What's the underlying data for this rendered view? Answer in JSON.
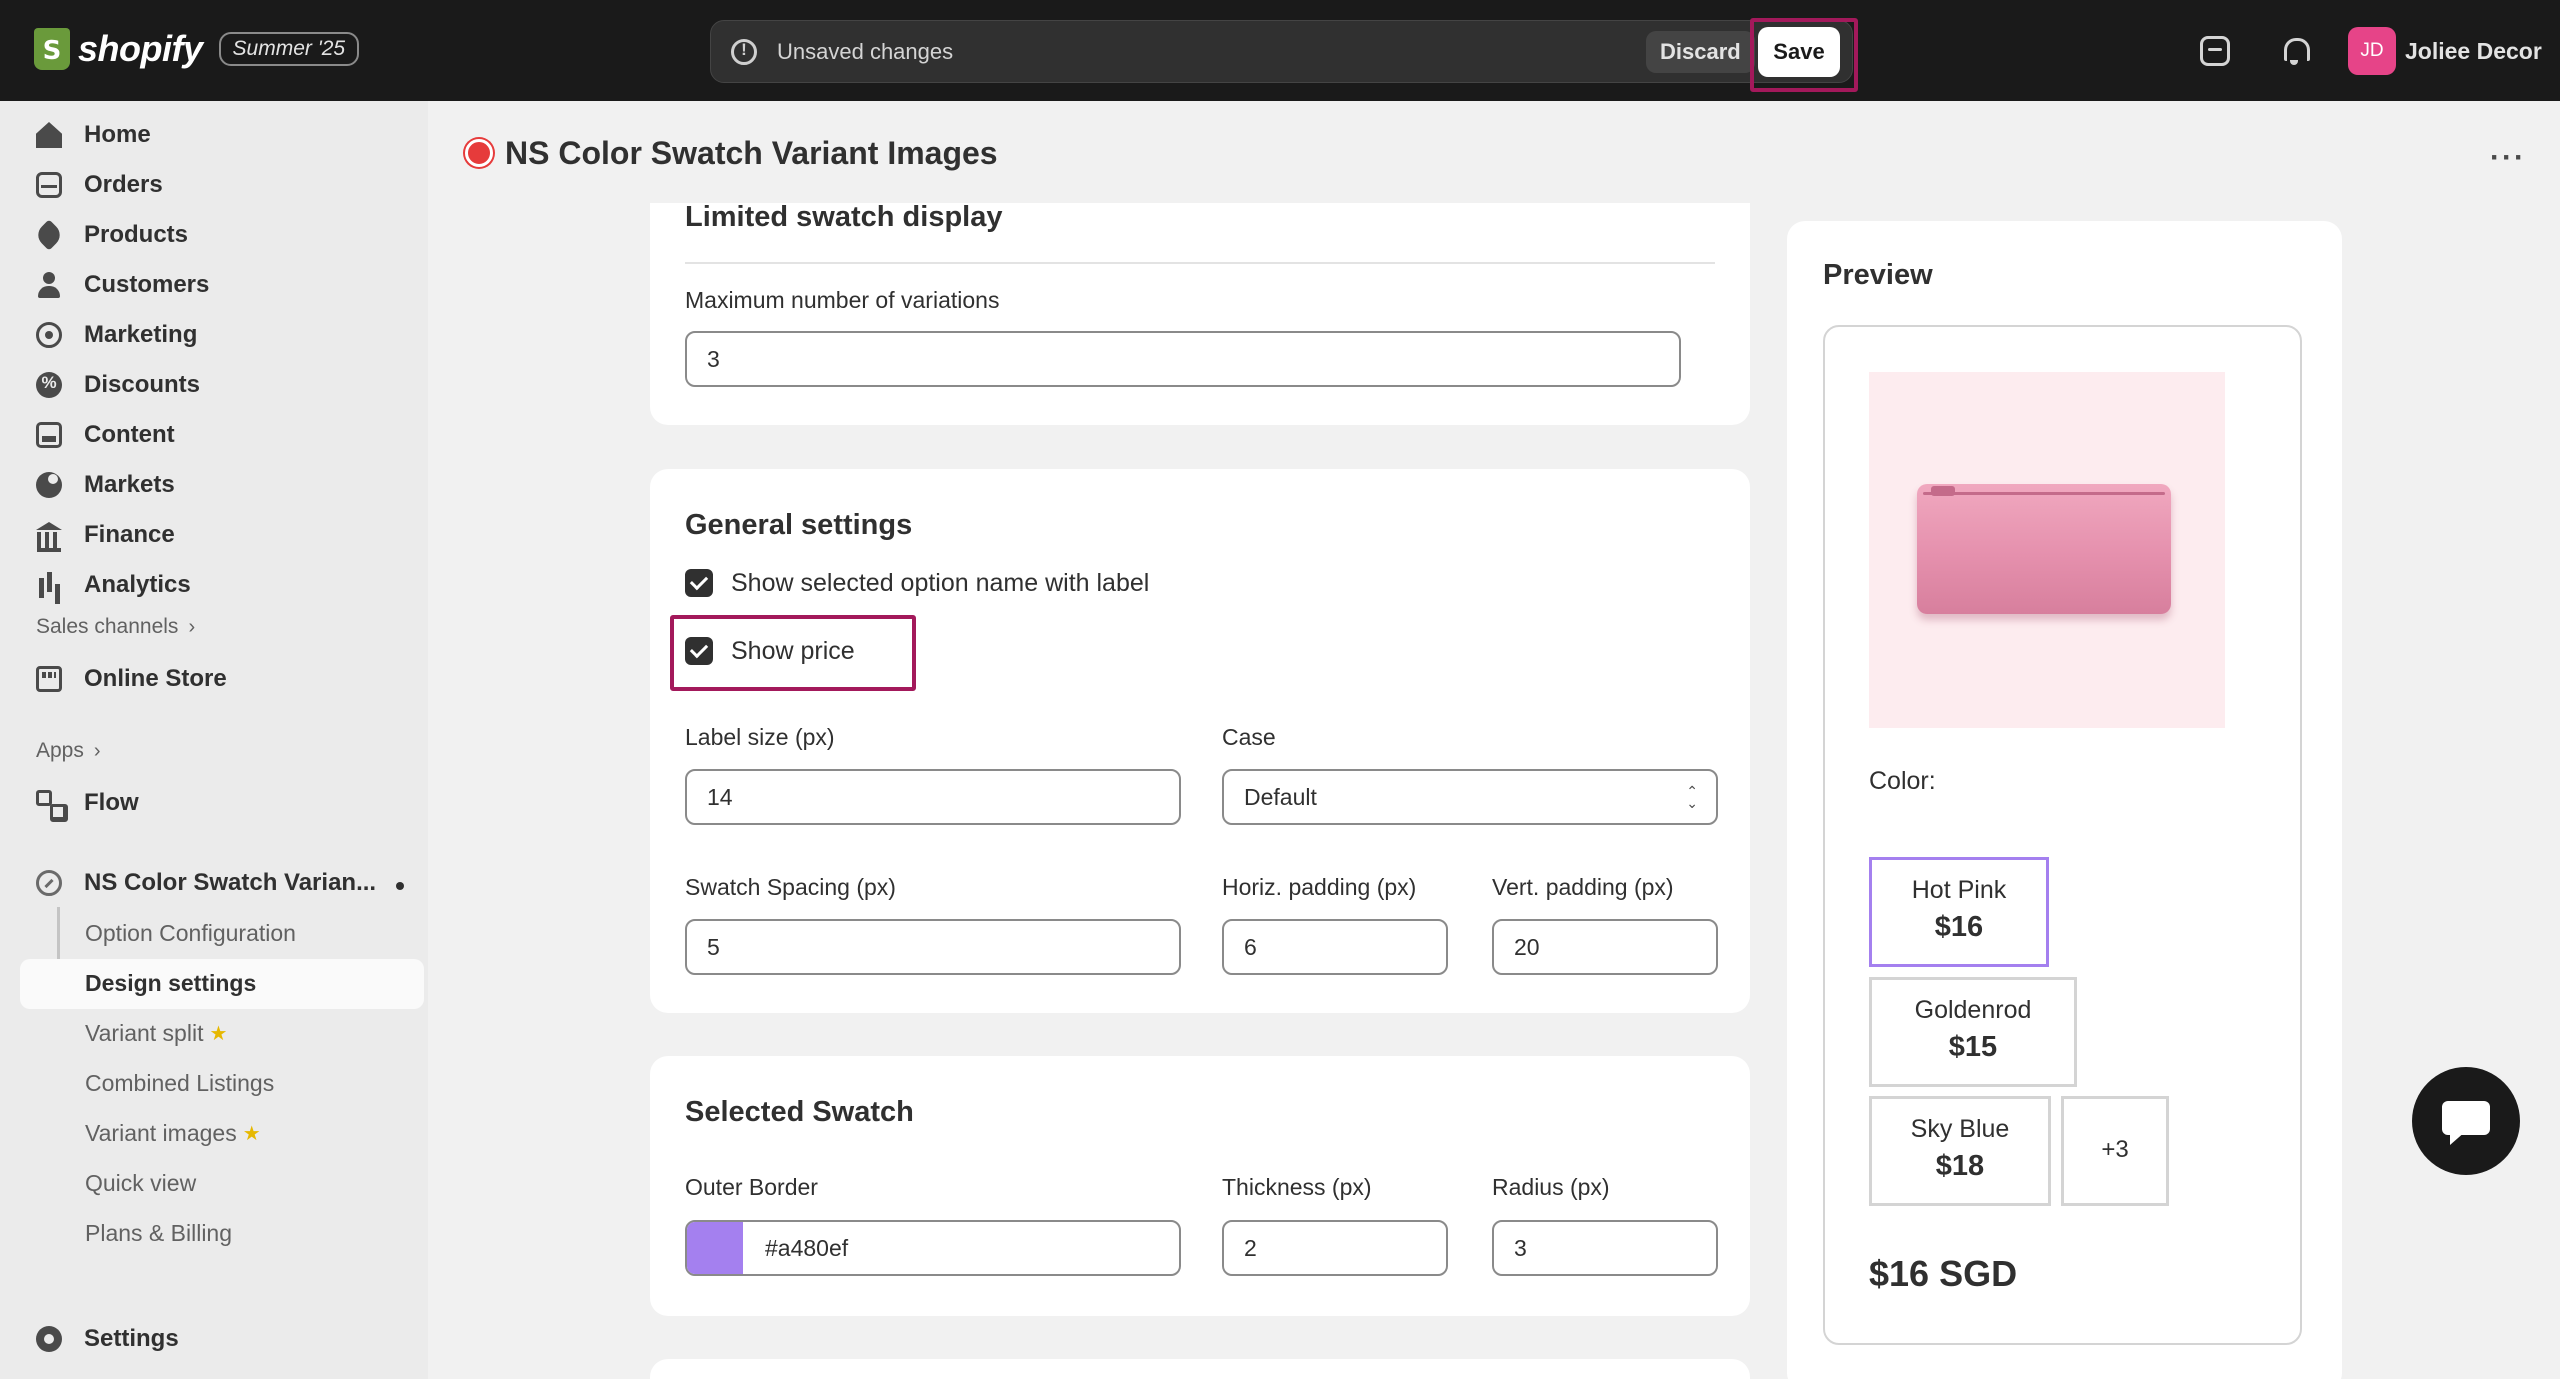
{
  "topbar": {
    "brand": "shopify",
    "edition": "Summer '25",
    "unsaved_text": "Unsaved changes",
    "discard_label": "Discard",
    "save_label": "Save",
    "avatar_initials": "JD",
    "store_name": "Joliee Decor",
    "icons": [
      "shopify-logo",
      "search-icon",
      "bell-icon"
    ],
    "highlight_color": "#a3195b"
  },
  "sidebar": {
    "nav": [
      {
        "label": "Home",
        "icon": "home-icon"
      },
      {
        "label": "Orders",
        "icon": "orders-icon"
      },
      {
        "label": "Products",
        "icon": "tag-icon"
      },
      {
        "label": "Customers",
        "icon": "person-icon"
      },
      {
        "label": "Marketing",
        "icon": "target-icon"
      },
      {
        "label": "Discounts",
        "icon": "discount-icon"
      },
      {
        "label": "Content",
        "icon": "content-icon"
      },
      {
        "label": "Markets",
        "icon": "globe-icon"
      },
      {
        "label": "Finance",
        "icon": "bank-icon"
      },
      {
        "label": "Analytics",
        "icon": "bar-chart-icon"
      }
    ],
    "sales_channels_label": "Sales channels",
    "online_store_label": "Online Store",
    "apps_label": "Apps",
    "flow_label": "Flow",
    "app_name": "NS Color Swatch Varian...",
    "app_subitems": [
      {
        "label": "Option Configuration"
      },
      {
        "label": "Design settings",
        "selected": true
      },
      {
        "label": "Variant split",
        "starred": true
      },
      {
        "label": "Combined Listings"
      },
      {
        "label": "Variant images",
        "starred": true
      },
      {
        "label": "Quick view"
      },
      {
        "label": "Plans & Billing"
      }
    ],
    "settings_label": "Settings"
  },
  "page": {
    "title": "NS Color Swatch Variant Images"
  },
  "limited_swatch": {
    "title": "Limited swatch display",
    "max_label": "Maximum number of variations",
    "max_value": "3"
  },
  "general": {
    "title": "General settings",
    "show_option_name_label": "Show selected option name with label",
    "show_option_name_checked": true,
    "show_price_label": "Show price",
    "show_price_checked": true,
    "label_size_label": "Label size (px)",
    "label_size_value": "14",
    "case_label": "Case",
    "case_value": "Default",
    "spacing_label": "Swatch Spacing (px)",
    "spacing_value": "5",
    "hpad_label": "Horiz. padding (px)",
    "hpad_value": "6",
    "vpad_label": "Vert. padding (px)",
    "vpad_value": "20"
  },
  "selected_swatch": {
    "title": "Selected Swatch",
    "outer_border_label": "Outer Border",
    "outer_border_value": "#a480ef",
    "thickness_label": "Thickness (px)",
    "thickness_value": "2",
    "radius_label": "Radius (px)",
    "radius_value": "3"
  },
  "preview": {
    "title": "Preview",
    "color_label": "Color:",
    "swatches": [
      {
        "name": "Hot Pink",
        "price": "$16",
        "selected": true
      },
      {
        "name": "Goldenrod",
        "price": "$15"
      },
      {
        "name": "Sky Blue",
        "price": "$18"
      }
    ],
    "more_label": "+3",
    "price": "$16 SGD",
    "product_image": "pink-pouch-image"
  }
}
